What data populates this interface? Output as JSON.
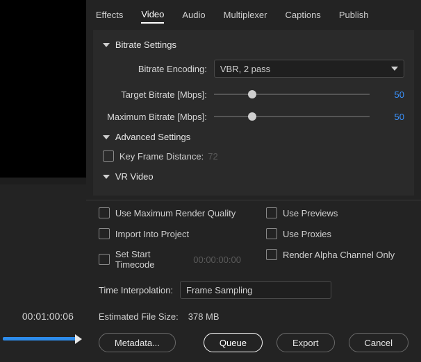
{
  "tabs": {
    "effects": "Effects",
    "video": "Video",
    "audio": "Audio",
    "multiplexer": "Multiplexer",
    "captions": "Captions",
    "publish": "Publish"
  },
  "sections": {
    "bitrate": {
      "title": "Bitrate Settings",
      "encoding": {
        "label": "Bitrate Encoding:",
        "value": "VBR, 2 pass"
      },
      "target": {
        "label": "Target Bitrate [Mbps]:",
        "value": "50"
      },
      "max": {
        "label": "Maximum Bitrate [Mbps]:",
        "value": "50"
      }
    },
    "advanced": {
      "title": "Advanced Settings",
      "keyframe": {
        "label": "Key Frame Distance:",
        "placeholder": "72"
      }
    },
    "vr": {
      "title": "VR Video"
    }
  },
  "footer": {
    "useMaxRender": "Use Maximum Render Quality",
    "usePreviews": "Use Previews",
    "importProject": "Import Into Project",
    "useProxies": "Use Proxies",
    "setStartTC": "Set Start Timecode",
    "startTCValue": "00:00:00:00",
    "renderAlpha": "Render Alpha Channel Only",
    "timeInterp": {
      "label": "Time Interpolation:",
      "value": "Frame Sampling"
    },
    "est": {
      "label": "Estimated File Size:",
      "value": "378 MB"
    },
    "buttons": {
      "metadata": "Metadata...",
      "queue": "Queue",
      "export": "Export",
      "cancel": "Cancel"
    }
  },
  "timeline": {
    "timecode": "00:01:00:06"
  }
}
